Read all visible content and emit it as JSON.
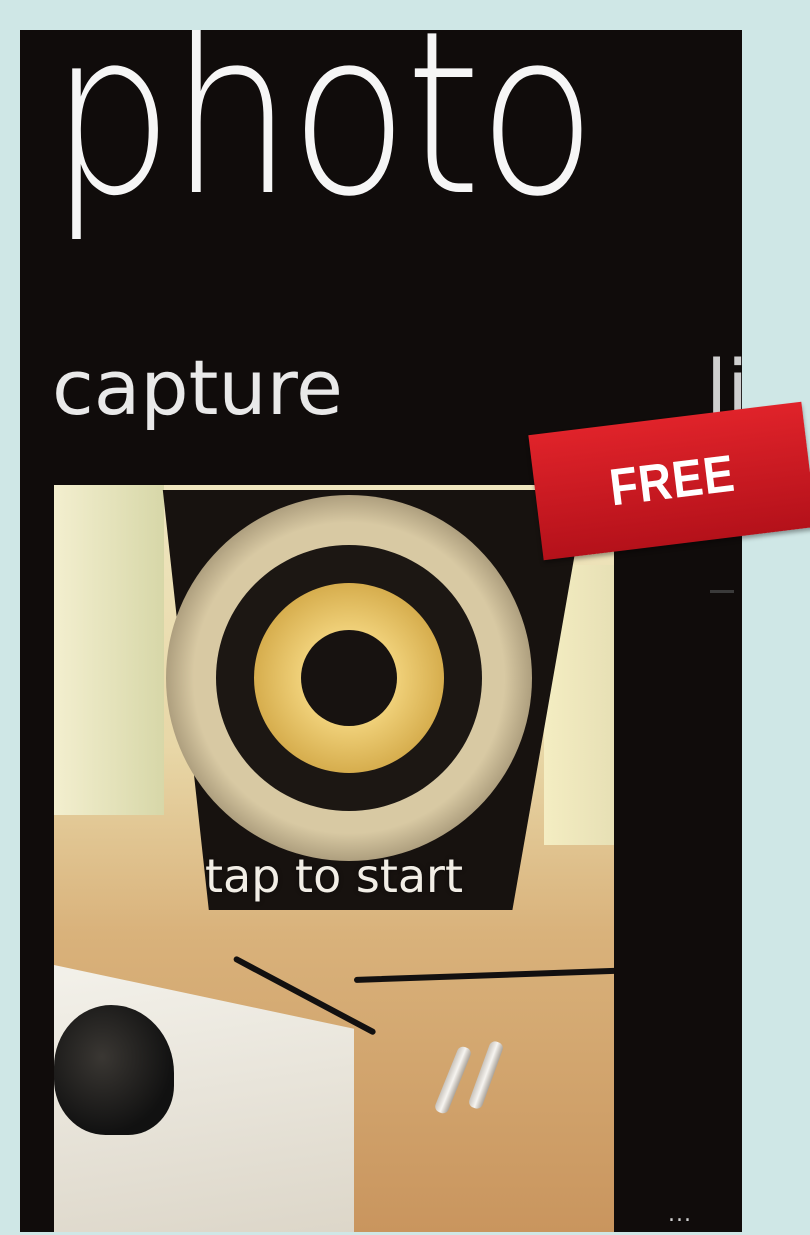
{
  "app": {
    "title": "photo"
  },
  "pivot": {
    "items": [
      {
        "label": "capture"
      },
      {
        "label": "li"
      }
    ]
  },
  "viewfinder": {
    "hint": "tap to start"
  },
  "appbar": {
    "more": "..."
  },
  "badge": {
    "label": "FREE",
    "color": "#d11b22"
  }
}
